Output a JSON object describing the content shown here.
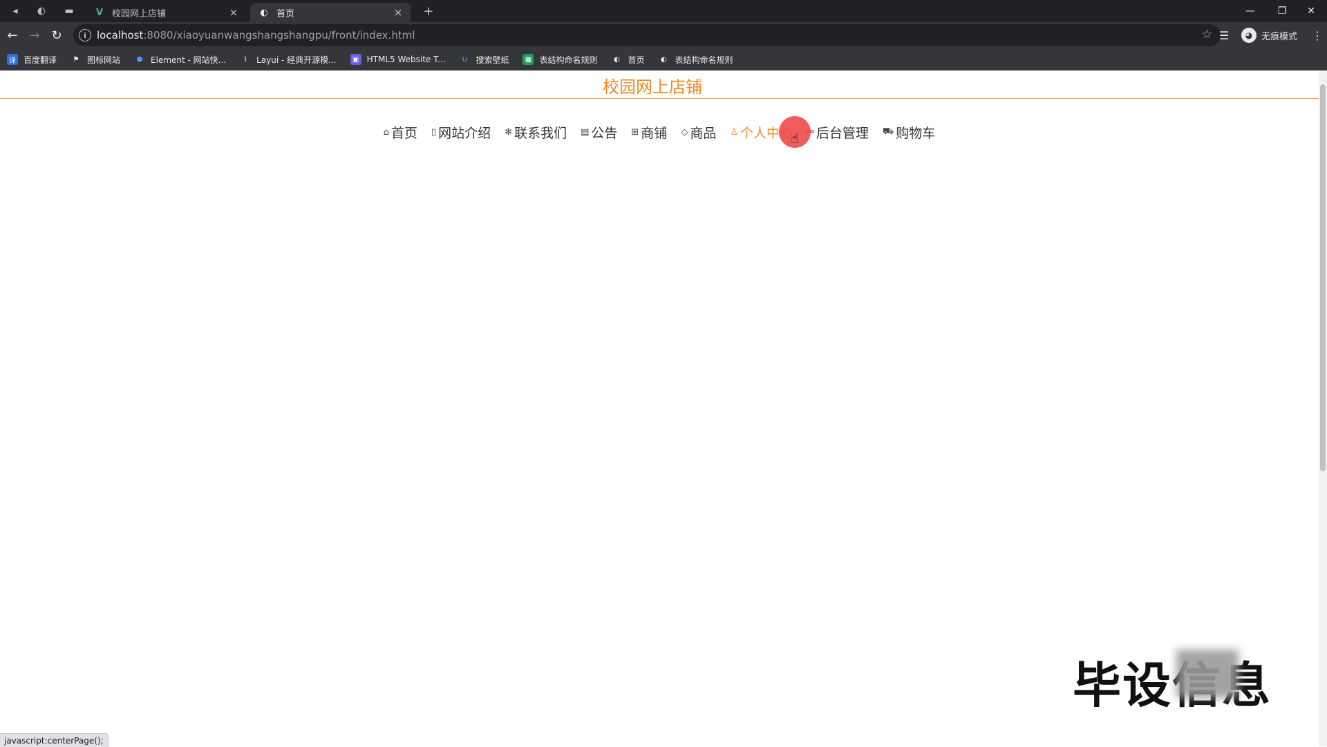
{
  "browser": {
    "tabs": [
      {
        "title": "校园网上店铺",
        "favicon": "vue-icon",
        "active": false
      },
      {
        "title": "首页",
        "favicon": "globe-icon",
        "active": true
      }
    ],
    "new_tab_symbol": "+",
    "url_host": "localhost",
    "url_rest": ":8080/xiaoyuanwangshangshangpu/front/index.html",
    "incognito_label": "无痕模式",
    "bookmarks": [
      {
        "label": "百度翻译",
        "icon": "translate-icon",
        "color": "#2b6de3"
      },
      {
        "label": "图标网站",
        "icon": "flag-icon",
        "color": "#3c4043"
      },
      {
        "label": "Element - 网站快...",
        "icon": "element-icon",
        "color": "#409eff"
      },
      {
        "label": "Layui - 经典开源模...",
        "icon": "layui-icon",
        "color": "#3c4043"
      },
      {
        "label": "HTML5 Website T...",
        "icon": "html5-icon",
        "color": "#6c5ce7"
      },
      {
        "label": "搜索壁纸",
        "icon": "wallpaper-icon",
        "color": "#2d7cf0"
      },
      {
        "label": "表结构命名规则",
        "icon": "sheet-icon",
        "color": "#1e9e5a"
      },
      {
        "label": "首页",
        "icon": "globe-icon",
        "color": "#3c4043"
      },
      {
        "label": "表结构命名规则",
        "icon": "globe-icon",
        "color": "#3c4043"
      }
    ],
    "status_text": "javascript:centerPage();"
  },
  "page": {
    "site_title": "校园网上店铺",
    "accent_color": "#f08a24",
    "nav": [
      {
        "label": "首页",
        "icon": "home-icon"
      },
      {
        "label": "网站介绍",
        "icon": "document-icon"
      },
      {
        "label": "联系我们",
        "icon": "asterisk-icon"
      },
      {
        "label": "公告",
        "icon": "notice-icon"
      },
      {
        "label": "商铺",
        "icon": "shop-icon"
      },
      {
        "label": "商品",
        "icon": "tag-icon"
      },
      {
        "label": "个人中心",
        "icon": "user-icon",
        "active": true
      },
      {
        "label": "后台管理",
        "icon": "link-icon"
      },
      {
        "label": "购物车",
        "icon": "cart-icon"
      }
    ]
  },
  "overlay": {
    "watermark_text": "毕设信息"
  }
}
